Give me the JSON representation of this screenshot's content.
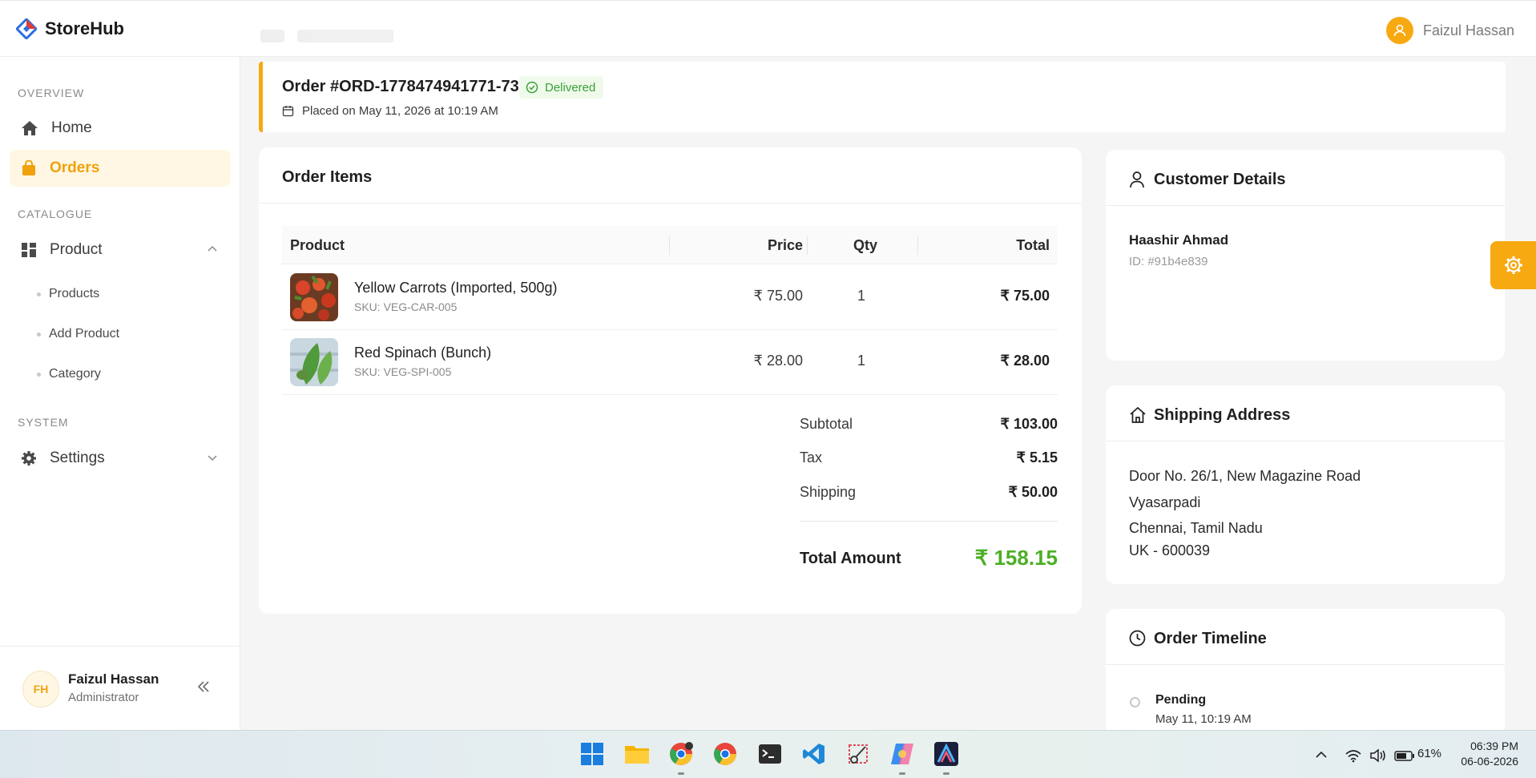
{
  "app": {
    "name": "StoreHub"
  },
  "header": {
    "user_name": "Faizul Hassan"
  },
  "sidebar": {
    "sections": [
      {
        "label": "OVERVIEW"
      },
      {
        "label": "CATALOGUE"
      },
      {
        "label": "SYSTEM"
      }
    ],
    "items": {
      "home": "Home",
      "orders": "Orders",
      "product": "Product",
      "settings": "Settings"
    },
    "product_sub": [
      "Products",
      "Add Product",
      "Category"
    ],
    "footer": {
      "initials": "FH",
      "name": "Faizul Hassan",
      "role": "Administrator"
    }
  },
  "order": {
    "id": "Order #ORD-1778474941771-73",
    "status": "Delivered",
    "placed": "Placed on May 11, 2026 at 10:19 AM"
  },
  "items_card": {
    "title": "Order Items",
    "columns": [
      "Product",
      "Price",
      "Qty",
      "Total"
    ],
    "rows": [
      {
        "name": "Yellow Carrots (Imported, 500g)",
        "sku": "SKU: VEG-CAR-005",
        "price": "₹ 75.00",
        "qty": "1",
        "total": "₹ 75.00"
      },
      {
        "name": "Red Spinach (Bunch)",
        "sku": "SKU: VEG-SPI-005",
        "price": "₹ 28.00",
        "qty": "1",
        "total": "₹ 28.00"
      }
    ],
    "summary": {
      "subtotal_label": "Subtotal",
      "subtotal": "₹ 103.00",
      "tax_label": "Tax",
      "tax": "₹ 5.15",
      "shipping_label": "Shipping",
      "shipping": "₹ 50.00",
      "total_label": "Total Amount",
      "total": "₹ 158.15"
    }
  },
  "customer": {
    "title": "Customer Details",
    "name": "Haashir Ahmad",
    "id": "ID: #91b4e839"
  },
  "shipping": {
    "title": "Shipping Address",
    "lines": [
      "Door No. 26/1, New Magazine Road",
      "Vyasarpadi",
      "Chennai, Tamil Nadu",
      "UK - 600039"
    ]
  },
  "timeline": {
    "title": "Order Timeline",
    "events": [
      {
        "status": "Pending",
        "time": "May 11, 10:19 AM"
      }
    ]
  },
  "taskbar": {
    "battery": "61%",
    "time": "06:39 PM",
    "date": "06-06-2026"
  },
  "colors": {
    "accent": "#f7a912",
    "success": "#4caf25"
  }
}
